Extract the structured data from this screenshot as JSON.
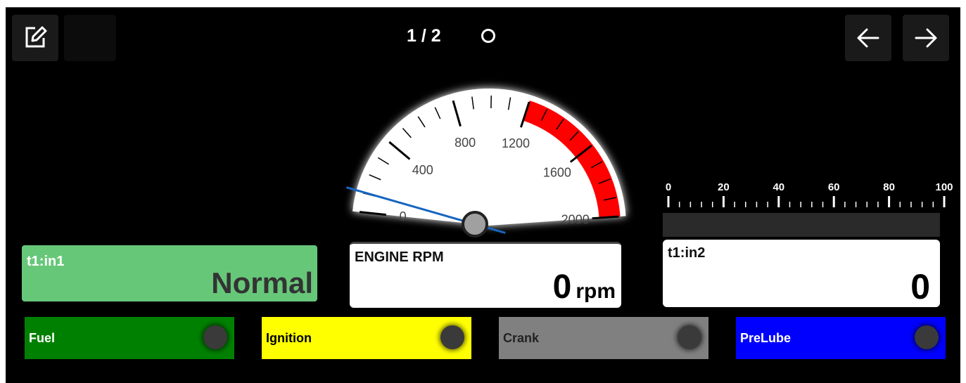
{
  "toolbar": {
    "page_indicator": "1 / 2",
    "edit_icon": "edit-icon",
    "prev_icon": "arrow-left-icon",
    "next_icon": "arrow-right-icon"
  },
  "gauge": {
    "title": "ENGINE RPM",
    "min": 0,
    "max": 2000,
    "value": 0,
    "unit": "rpm",
    "tick_labels": [
      "0",
      "400",
      "800",
      "1200",
      "1600",
      "2000"
    ],
    "redline_start": 1200,
    "redline_color": "#ff0000",
    "needle_color": "#1565c0"
  },
  "panels": {
    "in1": {
      "label": "t1:in1",
      "value": "Normal",
      "color": "#67c779"
    },
    "rpm": {
      "label": "ENGINE RPM",
      "value": "0",
      "unit": "rpm"
    },
    "in2": {
      "label": "t1:in2",
      "value": "0"
    }
  },
  "bar": {
    "min": 0,
    "max": 100,
    "value": 0,
    "tick_labels": [
      "0",
      "20",
      "40",
      "60",
      "80",
      "100"
    ]
  },
  "indicators": [
    {
      "label": "Fuel",
      "color": "#008000"
    },
    {
      "label": "Ignition",
      "color": "#ffff00"
    },
    {
      "label": "Crank",
      "color": "#808080"
    },
    {
      "label": "PreLube",
      "color": "#0000ff"
    }
  ]
}
